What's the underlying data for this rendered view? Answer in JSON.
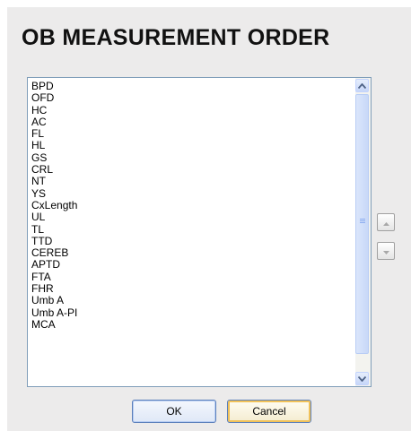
{
  "dialog": {
    "title": "OB MEASUREMENT ORDER"
  },
  "list": {
    "items": [
      "BPD",
      "OFD",
      "HC",
      "AC",
      "FL",
      "HL",
      "GS",
      "CRL",
      "NT",
      "YS",
      "CxLength",
      "UL",
      "TL",
      "TTD",
      "CEREB",
      "APTD",
      "FTA",
      "FHR",
      "Umb A",
      "Umb A-PI",
      "MCA"
    ]
  },
  "buttons": {
    "ok": "OK",
    "cancel": "Cancel"
  },
  "icons": {
    "scroll_up": "scroll-up-arrow-icon",
    "scroll_down": "scroll-down-arrow-icon",
    "move_up": "move-up-icon",
    "move_down": "move-down-icon"
  }
}
